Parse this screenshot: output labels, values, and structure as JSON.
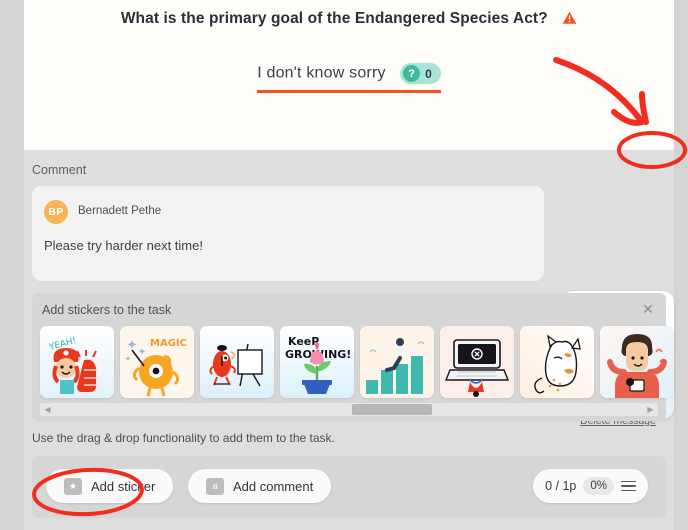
{
  "question": {
    "title": "What is the primary goal of the Endangered Species Act?",
    "warning_icon": "warning-triangle-icon",
    "answer": "I don't know sorry",
    "score_badge_icon": "question-mark-icon",
    "score_value": "0"
  },
  "comment_section": {
    "label": "Comment",
    "author_initials": "BP",
    "author_name": "Bernadett Pethe",
    "text": "Please try harder next time!",
    "delete_icon": "trash-icon",
    "delete_link": "Delete message"
  },
  "sticker_panel": {
    "title": "Add stickers to the task",
    "close_icon": "close-icon",
    "stickers": [
      {
        "name": "sticker-yeah-thumbs-up",
        "caption": "YEAH!"
      },
      {
        "name": "sticker-magic-monster",
        "caption": "MAGIC"
      },
      {
        "name": "sticker-monster-easel",
        "caption": ""
      },
      {
        "name": "sticker-keep-growing",
        "caption": "KEEP GROWING!"
      },
      {
        "name": "sticker-bar-chart-runner",
        "caption": ""
      },
      {
        "name": "sticker-laptop-error",
        "caption": ""
      },
      {
        "name": "sticker-cat",
        "caption": ""
      },
      {
        "name": "sticker-person-thinking",
        "caption": ""
      }
    ],
    "scrollbar": {
      "left_arrow_icon": "chevron-left-icon",
      "right_arrow_icon": "chevron-right-icon"
    }
  },
  "hint": "Use the drag & drop functionality to add them to the task.",
  "toolbar": {
    "add_sticker_label": "Add sticker",
    "add_sticker_icon": "sticker-star-icon",
    "add_comment_label": "Add comment",
    "add_comment_icon": "comment-bubble-icon",
    "points": "0 / 1p",
    "percent": "0%",
    "menu_icon": "hamburger-menu-icon"
  },
  "colors": {
    "accent_orange": "#f4511e",
    "badge_teal": "#a9e5d7",
    "badge_teal_dark": "#3fb8a0",
    "avatar_orange": "#f5b456",
    "annotation_red": "#f22d1f",
    "panel_gray": "#dedede"
  }
}
